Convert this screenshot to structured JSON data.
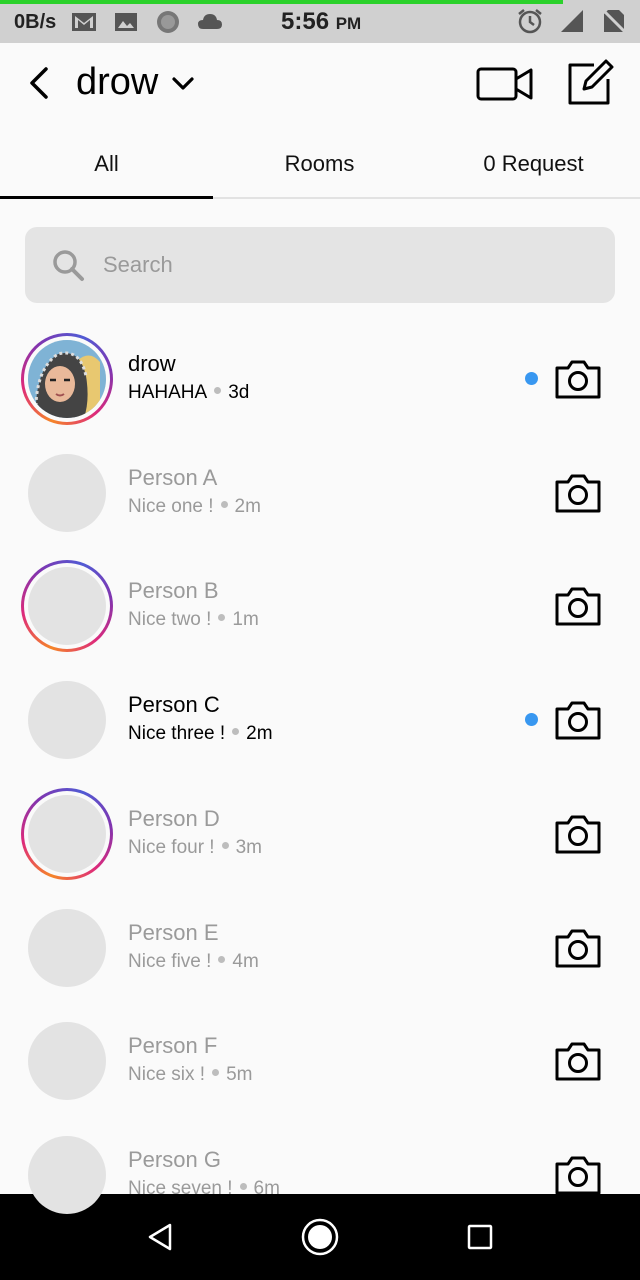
{
  "status_bar": {
    "net_speed": "0B/s",
    "time": "5:56",
    "ampm": "PM",
    "progress_fraction": 0.88,
    "icons": [
      "gmail-icon",
      "image-icon",
      "circle-icon",
      "cloud-icon",
      "alarm-icon",
      "signal-icon",
      "no-sim-icon"
    ]
  },
  "header": {
    "title": "drow",
    "icons": [
      "back-icon",
      "chevron-down-icon",
      "video-call-icon",
      "compose-icon"
    ]
  },
  "tabs": [
    {
      "label": "All",
      "active": true
    },
    {
      "label": "Rooms",
      "active": false
    },
    {
      "label": "0 Request",
      "active": false
    }
  ],
  "search": {
    "placeholder": "Search",
    "value": ""
  },
  "threads": [
    {
      "name": "drow",
      "message": "HAHAHA",
      "time": "3d",
      "unread": true,
      "story_ring": true,
      "has_photo": true
    },
    {
      "name": "Person A",
      "message": "Nice one !",
      "time": "2m",
      "unread": false,
      "story_ring": false
    },
    {
      "name": "Person B",
      "message": "Nice two !",
      "time": "1m",
      "unread": false,
      "story_ring": true
    },
    {
      "name": "Person C",
      "message": "Nice three !",
      "time": "2m",
      "unread": true,
      "story_ring": false
    },
    {
      "name": "Person D",
      "message": "Nice four !",
      "time": "3m",
      "unread": false,
      "story_ring": true
    },
    {
      "name": "Person E",
      "message": "Nice five !",
      "time": "4m",
      "unread": false,
      "story_ring": false
    },
    {
      "name": "Person F",
      "message": "Nice six !",
      "time": "5m",
      "unread": false,
      "story_ring": false
    },
    {
      "name": "Person G",
      "message": "Nice seven !",
      "time": "6m",
      "unread": false,
      "story_ring": false
    }
  ],
  "colors": {
    "unread_dot": "#3897f0",
    "status_progress": "#2bd12b",
    "story_ring": [
      "#f58529",
      "#dd2a7b",
      "#8134af"
    ]
  },
  "nav_bar": {
    "icons": [
      "nav-back-icon",
      "nav-home-icon",
      "nav-recents-icon"
    ]
  }
}
